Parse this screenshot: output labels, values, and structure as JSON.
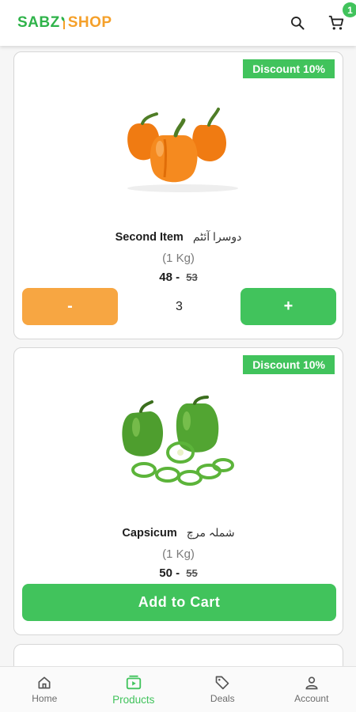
{
  "header": {
    "logo_part1": "SABZ",
    "logo_part2": "SHOP",
    "cart_count": "1",
    "search_icon": "search-icon",
    "cart_icon": "cart-icon"
  },
  "colors": {
    "brand_green": "#41c35c",
    "brand_orange": "#f7a642"
  },
  "products": [
    {
      "discount": "Discount 10%",
      "name": "Second Item",
      "name_urdu": "دوسرا آئٹم",
      "unit": "(1 Kg)",
      "price": "48 -",
      "old_price": "53",
      "quantity": "3",
      "minus_label": "-",
      "plus_label": "+",
      "image": "orange-bell-peppers"
    },
    {
      "discount": "Discount 10%",
      "name": "Capsicum",
      "name_urdu": "شملہ مرچ",
      "unit": "(1 Kg)",
      "price": "50 -",
      "old_price": "55",
      "add_to_cart_label": "Add to Cart",
      "image": "green-bell-peppers"
    }
  ],
  "bottom_nav": [
    {
      "label": "Home",
      "icon": "home-icon",
      "active": false
    },
    {
      "label": "Products",
      "icon": "products-icon",
      "active": true
    },
    {
      "label": "Deals",
      "icon": "tag-icon",
      "active": false
    },
    {
      "label": "Account",
      "icon": "account-icon",
      "active": false
    }
  ]
}
